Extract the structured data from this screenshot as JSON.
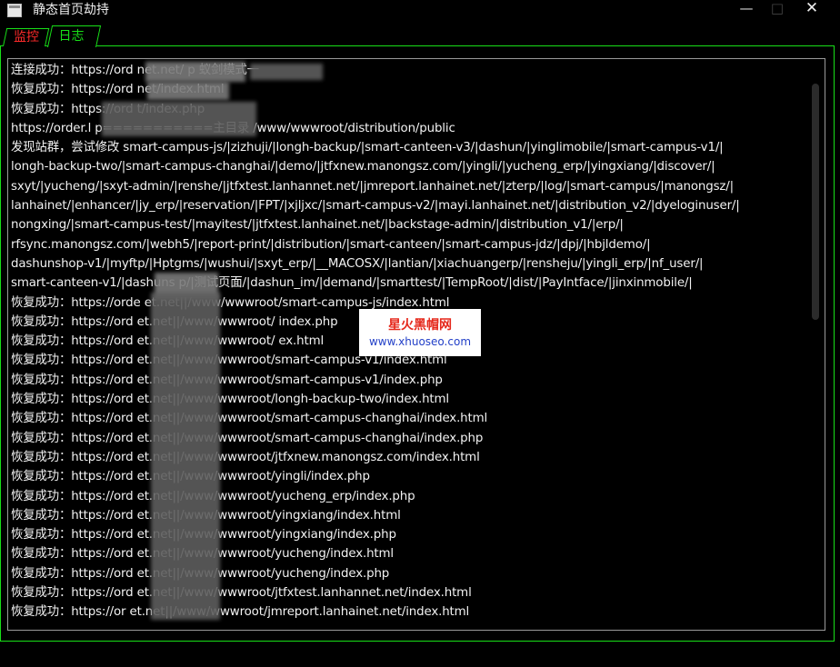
{
  "window": {
    "title": "静态首页劫持",
    "minimize": "—",
    "maximize": "□",
    "close": "✕"
  },
  "tabs": [
    {
      "label": "监控",
      "active": false
    },
    {
      "label": "日志",
      "active": true
    }
  ],
  "log": [
    "连接成功：https://ord                    net.net/                        p   蚁剑模式一",
    "恢复成功：https://ord                   net/index.html",
    "恢复成功：https://ord                     t/index.php",
    "https://order.l                        p===========主目录 /www/wwwroot/distribution/public",
    "发现站群，尝试修改 smart-campus-js/|zizhuji/|longh-backup/|smart-canteen-v3/|dashun/|yinglimobile/|smart-campus-v1/|",
    "longh-backup-two/|smart-campus-changhai/|demo/|jtfxnew.manongsz.com/|yingli/|yucheng_erp/|yingxiang/|discover/|",
    "sxyt/|yucheng/|sxyt-admin/|renshe/|jtfxtest.lanhannet.net/|jmreport.lanhainet.net/|zterp/|log/|smart-campus/|manongsz/|",
    "lanhainet/|enhancer/|jy_erp/|reservation/|FPT/|xjljxc/|smart-campus-v2/|mayi.lanhainet.net/|distribution_v2/|dyeloginuser/|",
    "nongxing/|smart-campus-test/|mayitest/|jtfxtest.lanhainet.net/|backstage-admin/|distribution_v1/|erp/|",
    "rfsync.manongsz.com/|webh5/|report-print/|distribution/|smart-canteen/|smart-campus-jdz/|dpj/|hbjldemo/|",
    "dashunshop-v1/|myftp/|Hptgms/|wushui/|sxyt_erp/|__MACOSX/|lantian/|xiachuangerp/|rensheju/|yingli_erp/|nf_user/|",
    "smart-canteen-v1/|dashuns   p/|测试页面/|dashun_im/|demand/|smarttest/|TempRoot/|dist/|PayIntface/|jinxinmobile/|",
    "恢复成功：https://orde                  et.net||/www/wwwroot/smart-campus-js/index.html",
    "恢复成功：https://ord                   et.net||/www/wwwroot/                     index.php",
    "恢复成功：https://ord                   et.net||/www/wwwroot/                     ex.html",
    "恢复成功：https://ord                   et.net||/www/wwwroot/smart-campus-v1/index.html",
    "恢复成功：https://ord                   et.net||/www/wwwroot/smart-campus-v1/index.php",
    "恢复成功：https://ord                   et.net||/www/wwwroot/longh-backup-two/index.html",
    "恢复成功：https://ord                   et.net||/www/wwwroot/smart-campus-changhai/index.html",
    "恢复成功：https://ord                   et.net||/www/wwwroot/smart-campus-changhai/index.php",
    "恢复成功：https://ord                   et.net||/www/wwwroot/jtfxnew.manongsz.com/index.html",
    "恢复成功：https://ord                   et.net||/www/wwwroot/yingli/index.php",
    "恢复成功：https://ord                   et.net||/www/wwwroot/yucheng_erp/index.php",
    "恢复成功：https://ord                   et.net||/www/wwwroot/yingxiang/index.html",
    "恢复成功：https://ord                   et.net||/www/wwwroot/yingxiang/index.php",
    "恢复成功：https://ord                   et.net||/www/wwwroot/yucheng/index.html",
    "恢复成功：https://ord                   et.net||/www/wwwroot/yucheng/index.php",
    "恢复成功：https://ord                   et.net||/www/wwwroot/jtfxtest.lanhannet.net/index.html",
    "恢复成功：https://or                    et.net||/www/wwwroot/jmreport.lanhainet.net/index.html"
  ],
  "watermark": {
    "title": "星火黑帽网",
    "url": "www.xhuoseo.com"
  },
  "colors": {
    "accent": "#18e018",
    "inactive_tab": "#ff2a2a",
    "background": "#000000",
    "text": "#f2f2f2"
  }
}
